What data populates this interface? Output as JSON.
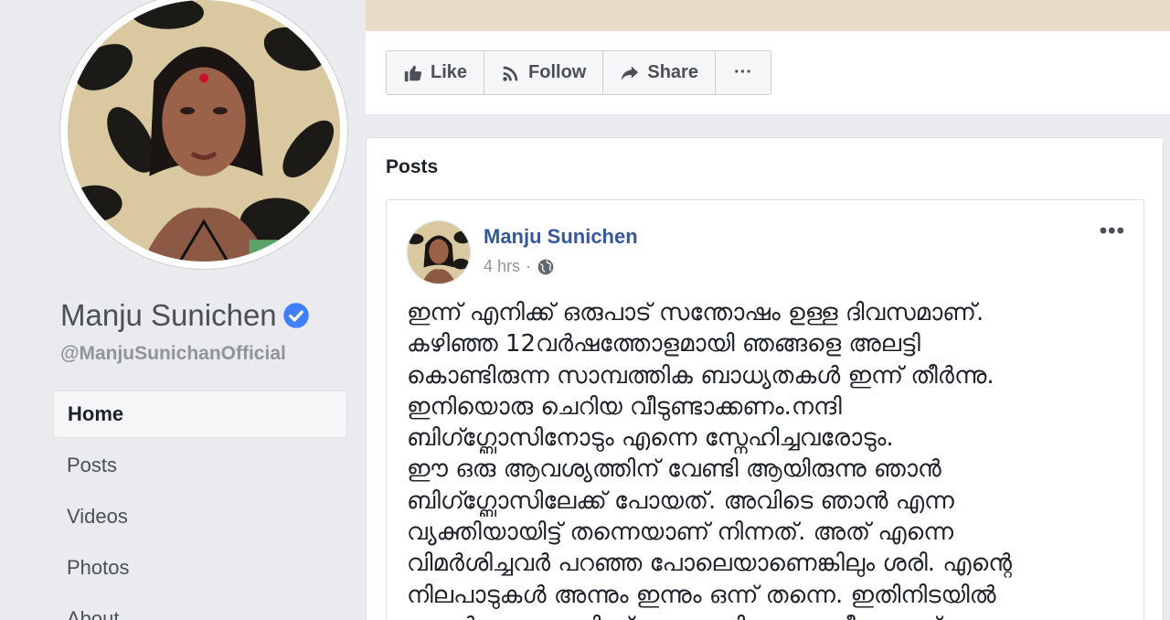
{
  "profile": {
    "name": "Manju Sunichen",
    "handle": "@ManjuSunichanOfficial"
  },
  "nav": {
    "items": [
      {
        "label": "Home",
        "active": true
      },
      {
        "label": "Posts"
      },
      {
        "label": "Videos"
      },
      {
        "label": "Photos"
      },
      {
        "label": "About"
      }
    ]
  },
  "actions": {
    "like_label": "Like",
    "follow_label": "Follow",
    "share_label": "Share",
    "more_label": "···"
  },
  "posts_section": {
    "title": "Posts"
  },
  "post": {
    "author": "Manju Sunichen",
    "time": "4 hrs",
    "more": "•••",
    "lines": [
      "ഇന്ന് എനിക്ക് ഒരുപാട് സന്തോഷം ഉള്ള ദിവസമാണ്.",
      "കഴിഞ്ഞ 12വർഷത്തോളമായി ഞങ്ങളെ അലട്ടി",
      "കൊണ്ടിരുന്ന സാമ്പത്തിക ബാധ്യതകൾ ഇന്ന് തീർന്നു.",
      "ഇനിയൊരു ചെറിയ വീടുണ്ടാക്കണം.നന്ദി",
      "ബിഗ്ഗ്ബോസിനോടും എന്നെ സ്നേഹിച്ചവരോടും.",
      "ഈ ഒരു ആവശ്യത്തിന് വേണ്ടി ആയിരുന്നു ഞാൻ",
      "ബിഗ്ഗ്ബോസിലേക്ക് പോയത്. അവിടെ ഞാൻ എന്ന",
      "വ്യക്തിയായിട്ട് തന്നെയാണ് നിന്നത്. അത് എന്നെ",
      "വിമർശിച്ചവർ പറഞ്ഞ പോലെയാണെങ്കിലും ശരി. എന്റെ",
      "നിലപാടുകൾ അന്നും ഇന്നും ഒന്ന് തന്നെ. ഇതിനിടയിൽ",
      "എന്റെ ഭാഗത്തു നിന്ന് വന്ന വലിയൊരു വീഴ്ചയാണ്"
    ]
  },
  "colors": {
    "background": "#e9ebee",
    "link_blue": "#365899",
    "verified_blue": "#4080ff"
  },
  "icons": [
    "like-icon",
    "follow-icon",
    "share-icon",
    "verified-badge-icon",
    "globe-icon"
  ]
}
